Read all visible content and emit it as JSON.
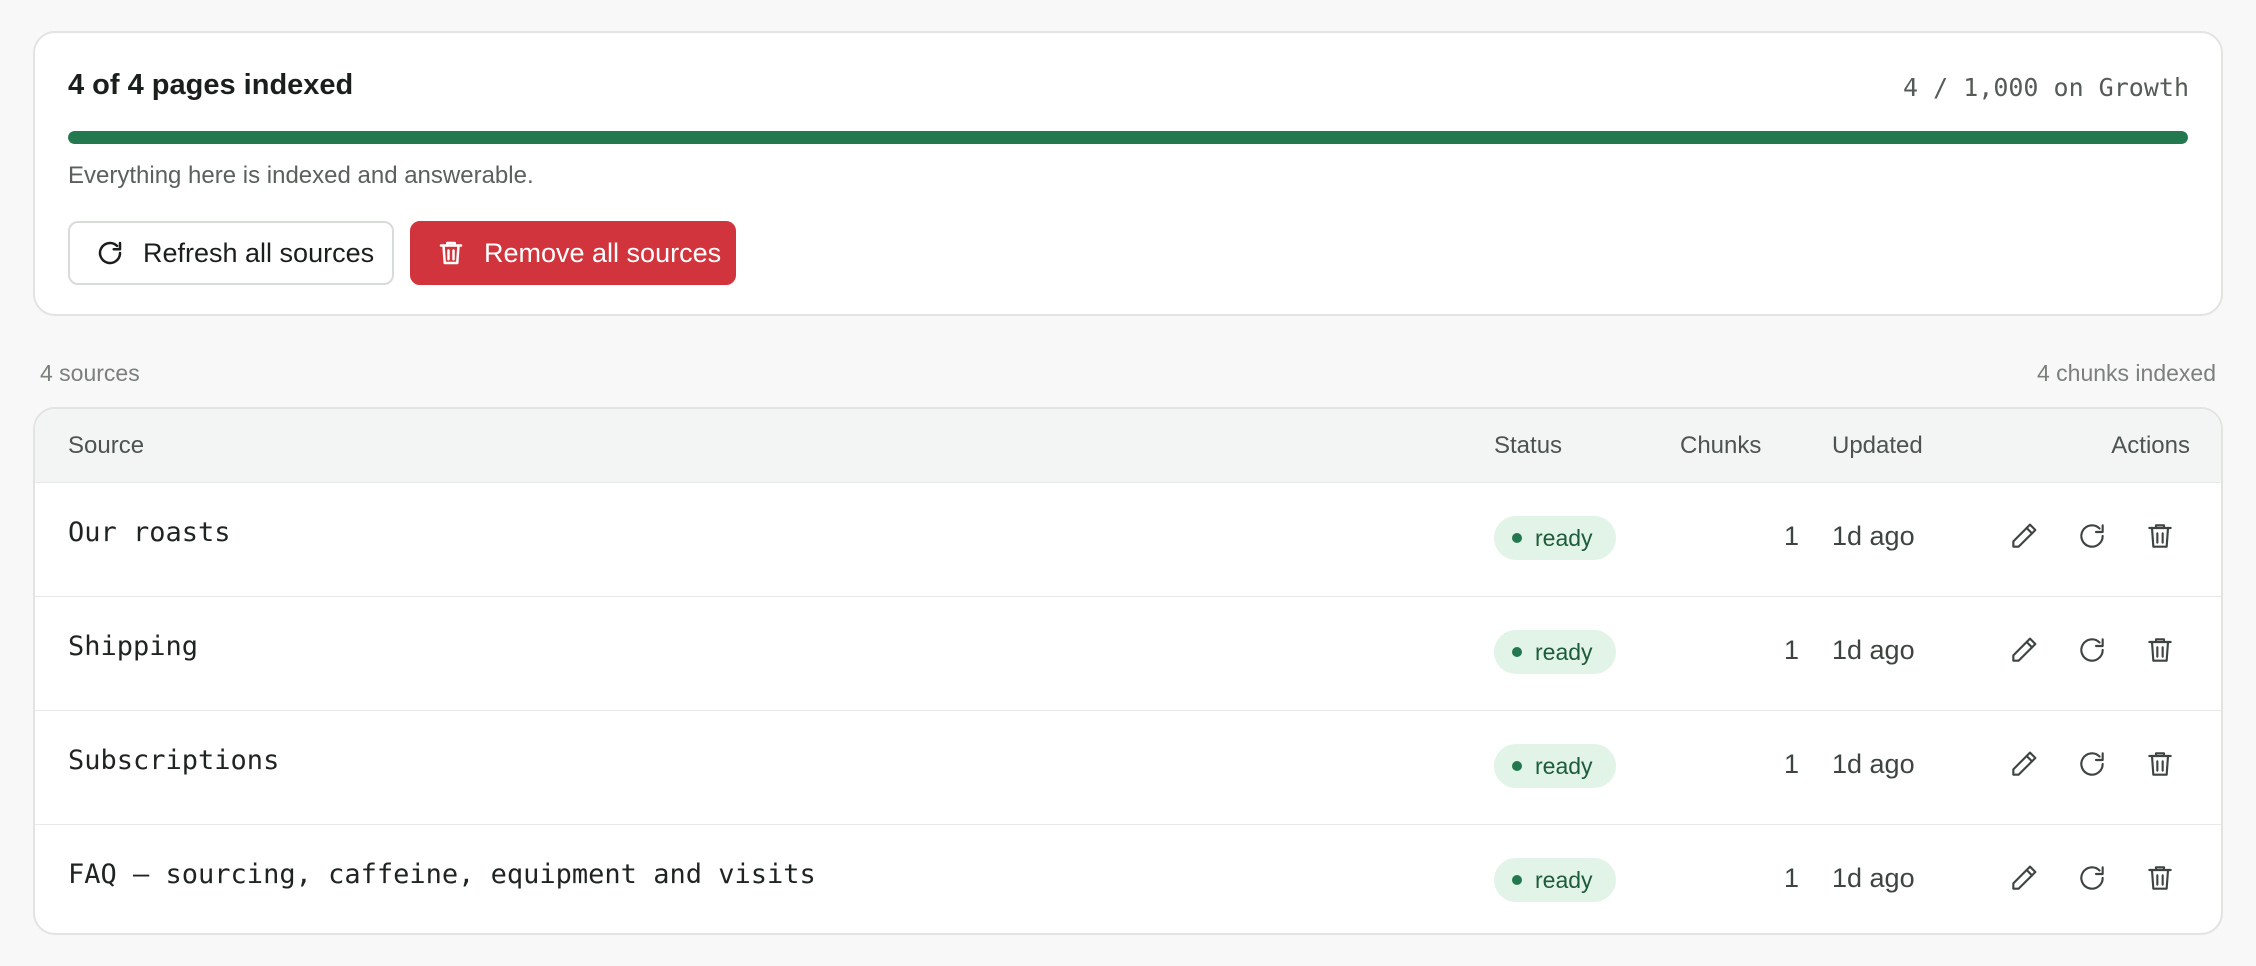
{
  "indexing": {
    "title": "4 of 4 pages indexed",
    "quota": "4 / 1,000 on Growth",
    "progress_fraction": 1.0,
    "note": "Everything here is indexed and answerable.",
    "refresh_label": "Refresh all sources",
    "remove_label": "Remove all sources"
  },
  "summary": {
    "sources_count": "4 sources",
    "chunks_indexed": "4 chunks indexed"
  },
  "table": {
    "headers": {
      "source": "Source",
      "status": "Status",
      "chunks": "Chunks",
      "updated": "Updated",
      "actions": "Actions"
    },
    "rows": [
      {
        "source": "Our roasts",
        "status": "ready",
        "chunks": "1",
        "updated": "1d ago"
      },
      {
        "source": "Shipping",
        "status": "ready",
        "chunks": "1",
        "updated": "1d ago"
      },
      {
        "source": "Subscriptions",
        "status": "ready",
        "chunks": "1",
        "updated": "1d ago"
      },
      {
        "source": "FAQ — sourcing, caffeine, equipment and visits",
        "status": "ready",
        "chunks": "1",
        "updated": "1d ago"
      }
    ]
  },
  "icons": {
    "refresh": "refresh-icon",
    "trash": "trash-icon",
    "edit": "pencil-icon"
  },
  "colors": {
    "accent_green": "#23784f",
    "danger_red": "#d1343c",
    "badge_bg": "#e2f3e8"
  }
}
